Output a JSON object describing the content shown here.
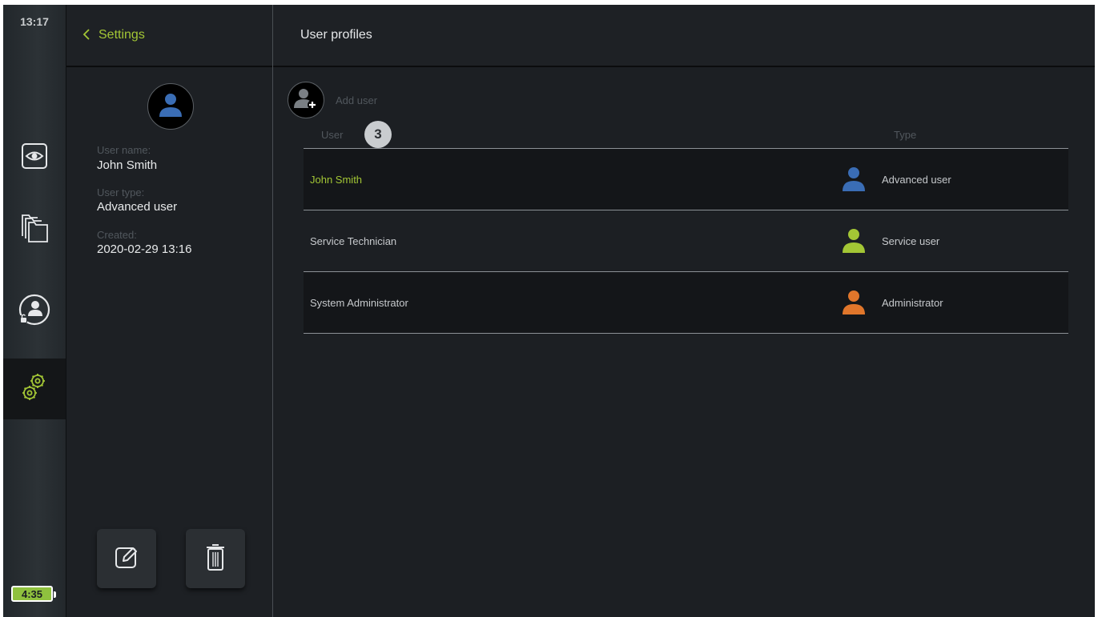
{
  "status": {
    "time": "13:17",
    "battery": "4:35"
  },
  "rail": {
    "items": [
      {
        "name": "live-view",
        "icon": "eye-icon"
      },
      {
        "name": "files",
        "icon": "folders-icon"
      },
      {
        "name": "login",
        "icon": "user-lock-icon"
      },
      {
        "name": "settings",
        "icon": "gears-icon",
        "active": true
      }
    ]
  },
  "detail": {
    "back_label": "Settings",
    "user_name_label": "User name:",
    "user_name": "John Smith",
    "user_type_label": "User type:",
    "user_type": "Advanced user",
    "created_label": "Created:",
    "created": "2020-02-29 13:16",
    "edit_icon": "edit-icon",
    "delete_icon": "trash-icon"
  },
  "main": {
    "title": "User profiles",
    "add_user_label": "Add user",
    "col_user": "User",
    "col_type": "Type",
    "callout": "3",
    "users": [
      {
        "name": "John Smith",
        "type": "Advanced user",
        "color": "#3a6db5",
        "selected": true
      },
      {
        "name": "Service Technician",
        "type": "Service user",
        "color": "#a3c635",
        "selected": false
      },
      {
        "name": "System Administrator",
        "type": "Administrator",
        "color": "#e0762b",
        "selected": false
      }
    ]
  },
  "colors": {
    "accent": "#a3c635",
    "advanced": "#3a6db5",
    "service": "#a3c635",
    "admin": "#e0762b"
  }
}
